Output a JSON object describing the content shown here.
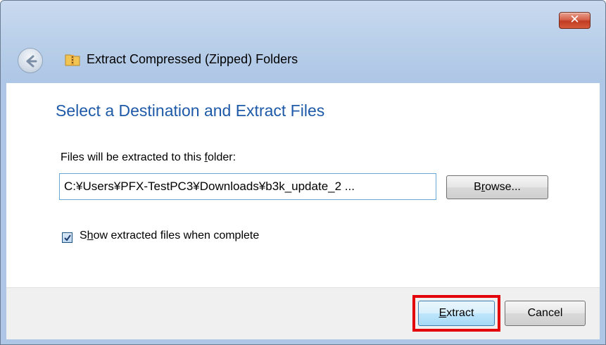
{
  "window": {
    "title": "Extract Compressed (Zipped) Folders",
    "close_glyph": "✕"
  },
  "main": {
    "heading": "Select a Destination and Extract Files",
    "field_label_pre": "Files will be extracted to this ",
    "field_label_key": "f",
    "field_label_post": "older:",
    "path_value": "C:¥Users¥PFX-TestPC3¥Downloads¥b3k_update_2 ...",
    "browse_pre": "B",
    "browse_key": "r",
    "browse_post": "owse...",
    "checkbox_checked": true,
    "checkbox_label_pre": "S",
    "checkbox_label_key": "h",
    "checkbox_label_post": "ow extracted files when complete"
  },
  "footer": {
    "extract_key": "E",
    "extract_post": "xtract",
    "cancel_label": "Cancel"
  },
  "colors": {
    "heading": "#1e5aa8",
    "highlight": "#e3000b",
    "close_button": "#c13b22"
  },
  "icons": [
    "back-arrow-icon",
    "zip-folder-icon",
    "close-icon",
    "checkmark-icon"
  ]
}
